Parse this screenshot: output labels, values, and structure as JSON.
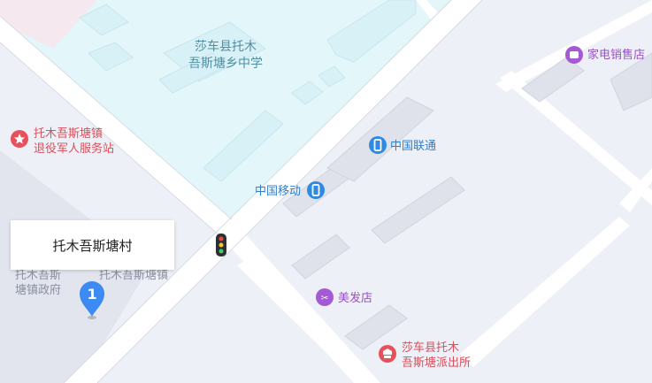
{
  "map": {
    "school_label": [
      "莎车县托木",
      "吾斯塘乡中学"
    ],
    "veteran_station": [
      "托木吾斯塘镇",
      "退役军人服务站"
    ],
    "government": [
      "托木吾斯",
      "塘镇政府"
    ],
    "government_partial": "托木吾斯塘镇",
    "appliance_store": "家电销售店",
    "china_unicom": "中国联通",
    "china_mobile": "中国移动",
    "hair_salon": "美发店",
    "police_station": [
      "莎车县托木",
      "吾斯塘派出所"
    ],
    "callout_title": "托木吾斯塘村",
    "marker_number": "1"
  },
  "colors": {
    "background": "#eef0f7",
    "road": "#ffffff",
    "school_area": "#e3f6fa",
    "building": "#e4e7ef",
    "marker_blue": "#3d8bf2"
  }
}
